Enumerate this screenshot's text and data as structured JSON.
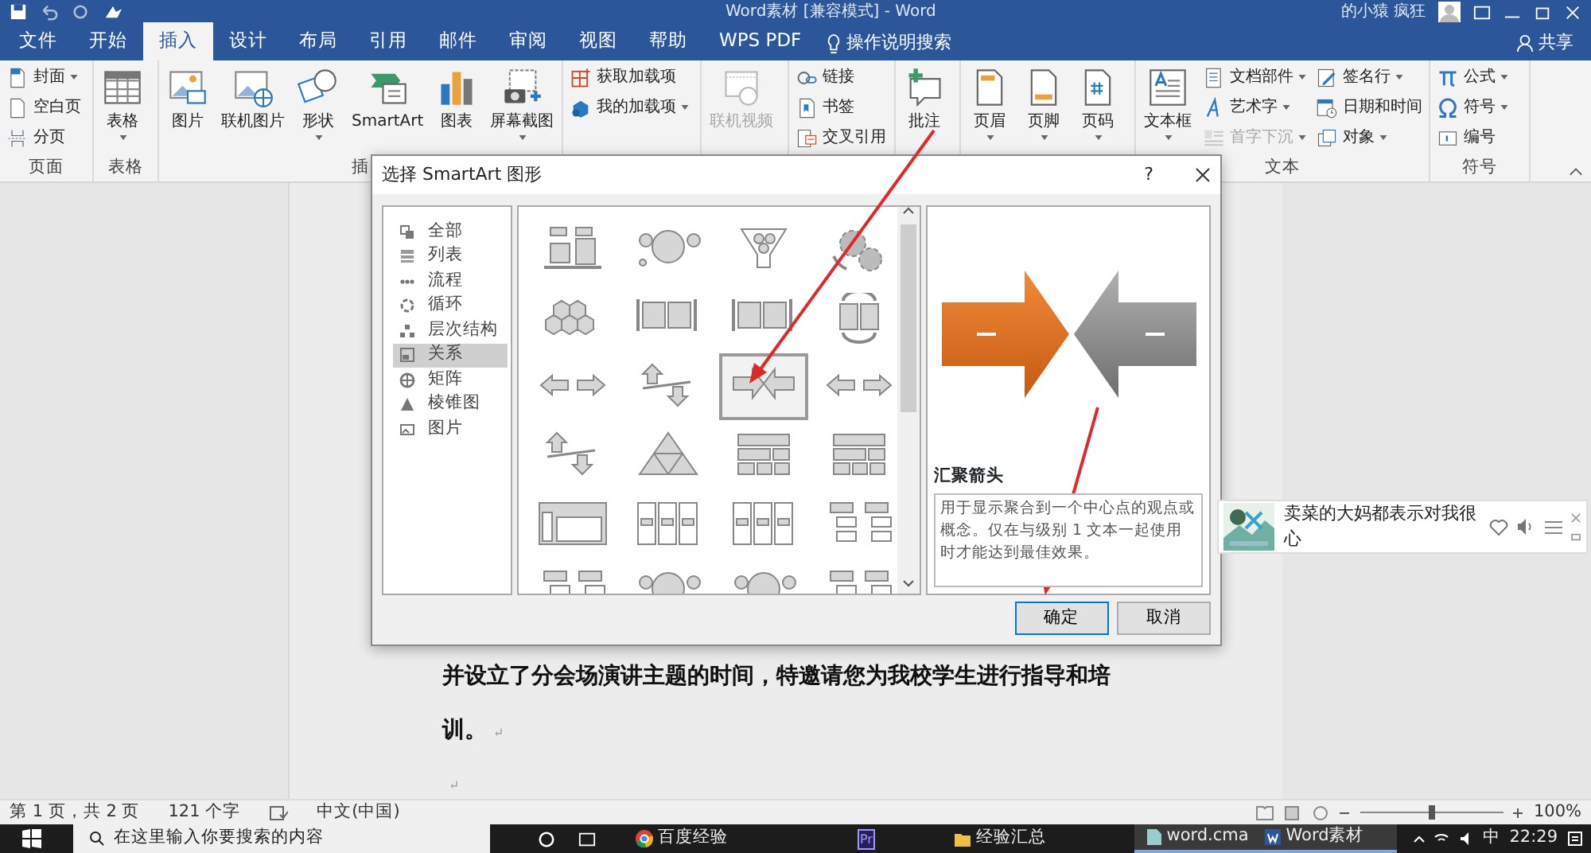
{
  "title_bar": {
    "title": "Word素材 [兼容模式] - Word",
    "user": "的小猿 疯狂"
  },
  "tabs": [
    {
      "label": "文件",
      "selected": false
    },
    {
      "label": "开始",
      "selected": false
    },
    {
      "label": "插入",
      "selected": true
    },
    {
      "label": "设计",
      "selected": false
    },
    {
      "label": "布局",
      "selected": false
    },
    {
      "label": "引用",
      "selected": false
    },
    {
      "label": "邮件",
      "selected": false
    },
    {
      "label": "审阅",
      "selected": false
    },
    {
      "label": "视图",
      "selected": false
    },
    {
      "label": "帮助",
      "selected": false
    },
    {
      "label": "WPS PDF",
      "selected": false
    }
  ],
  "tell_me": "操作说明搜索",
  "share": "共享",
  "ribbon": [
    {
      "label": "页面",
      "items": [
        {
          "kind": "small",
          "label": "封面",
          "dropdown": true,
          "disabled": false
        },
        {
          "kind": "small",
          "label": "空白页",
          "dropdown": false,
          "disabled": false
        },
        {
          "kind": "small",
          "label": "分页",
          "dropdown": false,
          "disabled": false
        }
      ]
    },
    {
      "label": "表格",
      "items": [
        {
          "kind": "large",
          "label": "表格",
          "dropdown": true,
          "disabled": false
        }
      ]
    },
    {
      "label": "插",
      "items": [
        {
          "kind": "large",
          "label": "图片",
          "dropdown": false,
          "disabled": false
        },
        {
          "kind": "large",
          "label": "联机图片",
          "dropdown": false,
          "disabled": false
        },
        {
          "kind": "large",
          "label": "形状",
          "dropdown": true,
          "disabled": false
        },
        {
          "kind": "large",
          "label": "SmartArt",
          "dropdown": false,
          "disabled": false
        },
        {
          "kind": "large",
          "label": "图表",
          "dropdown": false,
          "disabled": false
        },
        {
          "kind": "large",
          "label": "屏幕截图",
          "dropdown": true,
          "disabled": false
        }
      ]
    },
    {
      "items": [
        {
          "kind": "small",
          "label": "获取加载项",
          "dropdown": false,
          "disabled": false
        },
        {
          "kind": "small",
          "label": "我的加载项",
          "dropdown": true,
          "disabled": false
        }
      ]
    },
    {
      "items": [
        {
          "kind": "large",
          "label": "联机视频",
          "dropdown": false,
          "disabled": true
        }
      ]
    },
    {
      "items": [
        {
          "kind": "small",
          "label": "链接",
          "dropdown": false,
          "disabled": false
        },
        {
          "kind": "small",
          "label": "书签",
          "dropdown": false,
          "disabled": false
        },
        {
          "kind": "small",
          "label": "交叉引用",
          "dropdown": false,
          "disabled": false
        }
      ]
    },
    {
      "items": [
        {
          "kind": "large",
          "label": "批注",
          "dropdown": false,
          "disabled": false
        }
      ]
    },
    {
      "items": [
        {
          "kind": "large",
          "label": "页眉",
          "dropdown": true,
          "disabled": false
        },
        {
          "kind": "large",
          "label": "页脚",
          "dropdown": true,
          "disabled": false
        },
        {
          "kind": "large",
          "label": "页码",
          "dropdown": true,
          "disabled": false
        }
      ]
    },
    {
      "label": "文本",
      "items": [
        {
          "kind": "large",
          "label": "文本框",
          "dropdown": true,
          "disabled": false
        },
        {
          "kind": "small",
          "label": "文档部件",
          "dropdown": true,
          "disabled": false
        },
        {
          "kind": "small",
          "label": "艺术字",
          "dropdown": true,
          "disabled": false
        },
        {
          "kind": "small",
          "label": "首字下沉",
          "dropdown": true,
          "disabled": true
        },
        {
          "kind": "small",
          "label": "签名行",
          "dropdown": true,
          "disabled": false
        },
        {
          "kind": "small",
          "label": "日期和时间",
          "dropdown": false,
          "disabled": false
        },
        {
          "kind": "small",
          "label": "对象",
          "dropdown": true,
          "disabled": false
        }
      ]
    },
    {
      "label": "符号",
      "items": [
        {
          "kind": "small",
          "label": "公式",
          "dropdown": true,
          "disabled": false
        },
        {
          "kind": "small",
          "label": "符号",
          "dropdown": true,
          "disabled": false
        },
        {
          "kind": "small",
          "label": "编号",
          "dropdown": false,
          "disabled": false
        }
      ]
    }
  ],
  "document": {
    "lines": [
      {
        "text": "并设立了分会场演讲主题的时间，特邀请您为我校学生进行指导和培"
      },
      {
        "text": "训。",
        "return_mark": "↵"
      },
      {
        "return_mark": "↵"
      }
    ]
  },
  "dialog": {
    "title": "选择 SmartArt 图形",
    "help": "?",
    "categories": [
      {
        "label": "全部",
        "selected": false
      },
      {
        "label": "列表",
        "selected": false
      },
      {
        "label": "流程",
        "selected": false
      },
      {
        "label": "循环",
        "selected": false
      },
      {
        "label": "层次结构",
        "selected": false
      },
      {
        "label": "关系",
        "selected": true
      },
      {
        "label": "矩阵",
        "selected": false
      },
      {
        "label": "棱锥图",
        "selected": false
      },
      {
        "label": "图片",
        "selected": false
      }
    ],
    "gallery": [
      {
        "kind": "balance",
        "selected": false
      },
      {
        "kind": "circles",
        "selected": false
      },
      {
        "kind": "funnel",
        "selected": false
      },
      {
        "kind": "gears",
        "selected": false
      },
      {
        "kind": "hexagons",
        "selected": false
      },
      {
        "kind": "blocks",
        "selected": false
      },
      {
        "kind": "blocks",
        "selected": false
      },
      {
        "kind": "cycle",
        "selected": false
      },
      {
        "kind": "arrows",
        "selected": false
      },
      {
        "kind": "updown",
        "selected": false
      },
      {
        "kind": "converging",
        "selected": true
      },
      {
        "kind": "arrows",
        "selected": false
      },
      {
        "kind": "updown",
        "selected": false
      },
      {
        "kind": "pyramid",
        "selected": false
      },
      {
        "kind": "grid",
        "selected": false
      },
      {
        "kind": "grid",
        "selected": false
      },
      {
        "kind": "nested",
        "selected": false
      },
      {
        "kind": "columns",
        "selected": false
      },
      {
        "kind": "columns",
        "selected": false
      },
      {
        "kind": "tree",
        "selected": false
      },
      {
        "kind": "tree",
        "selected": false
      },
      {
        "kind": "circles",
        "selected": false
      },
      {
        "kind": "circles",
        "selected": false
      },
      {
        "kind": "tree",
        "selected": false
      }
    ],
    "preview": {
      "name": "汇聚箭头",
      "description": "用于显示聚合到一个中心点的观点或概念。仅在与级别 1 文本一起使用时才能达到最佳效果。"
    },
    "buttons": [
      {
        "label": "确定",
        "default": true
      },
      {
        "label": "取消",
        "default": false
      }
    ]
  },
  "notification": {
    "text": "卖菜的大妈都表示对我很心"
  },
  "status_bar": {
    "page": "第 1 页，共 2 页",
    "words": "121 个字",
    "language": "中文(中国)",
    "zoom": "100%",
    "zoom_slider": {
      "level": 0.5
    }
  },
  "taskbar": {
    "search": "在这里输入你要搜索的内容",
    "apps": [
      {
        "kind": "chrome",
        "label": "百度经验"
      },
      {
        "kind": "premiere",
        "label": "Pr"
      },
      {
        "kind": "folder",
        "label": "经验汇总"
      },
      {
        "kind": "file",
        "label": "word.cma"
      },
      {
        "kind": "word",
        "label": "Word素材"
      }
    ],
    "ime": "中",
    "time": "22:29"
  }
}
